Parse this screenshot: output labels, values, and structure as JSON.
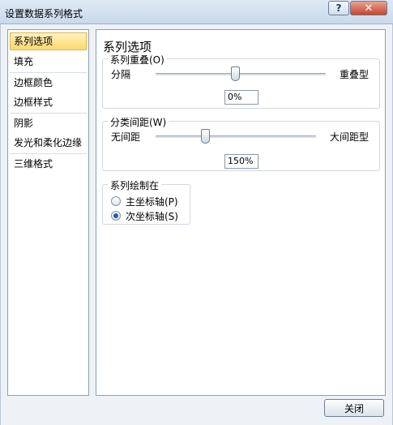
{
  "window": {
    "title": "设置数据系列格式",
    "help_icon": "?",
    "close_icon": "✕"
  },
  "sidebar": {
    "items": [
      {
        "label": "系列选项",
        "selected": true
      },
      {
        "label": "填充",
        "selected": false
      },
      {
        "label": "边框颜色",
        "selected": false
      },
      {
        "label": "边框样式",
        "selected": false
      },
      {
        "label": "阴影",
        "selected": false
      },
      {
        "label": "发光和柔化边缘",
        "selected": false
      },
      {
        "label": "三维格式",
        "selected": false
      }
    ]
  },
  "panel": {
    "title": "系列选项",
    "overlap": {
      "group_label": "系列重叠(O)",
      "left_label": "分隔",
      "right_label": "重叠型",
      "value": "0%",
      "slider_fraction": 0.5
    },
    "gap": {
      "group_label": "分类间距(W)",
      "left_label": "无间距",
      "right_label": "大间距型",
      "value": "150%",
      "slider_fraction": 0.3
    },
    "plot_on": {
      "group_label": "系列绘制在",
      "options": [
        {
          "label": "主坐标轴(P)",
          "checked": false
        },
        {
          "label": "次坐标轴(S)",
          "checked": true
        }
      ]
    }
  },
  "footer": {
    "close_label": "关闭"
  }
}
